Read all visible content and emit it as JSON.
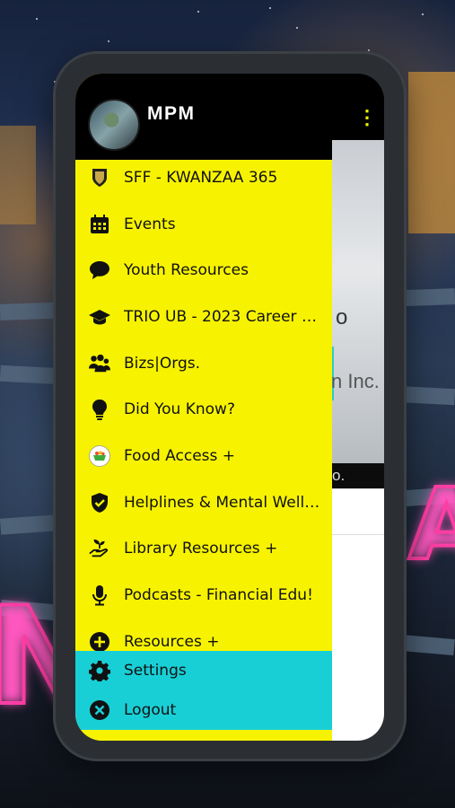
{
  "header": {
    "user_name": "MPM"
  },
  "menu": {
    "items": [
      {
        "label": "SFF - KWANZAA 365",
        "icon": "shield-badge-icon"
      },
      {
        "label": "Events",
        "icon": "calendar-icon"
      },
      {
        "label": "Youth Resources",
        "icon": "speech-bubble-icon"
      },
      {
        "label": "TRIO UB - 2023 Career R...",
        "icon": "graduation-cap-icon"
      },
      {
        "label": "Bizs|Orgs.",
        "icon": "group-icon"
      },
      {
        "label": "Did You Know?",
        "icon": "lightbulb-icon"
      },
      {
        "label": "Food Access +",
        "icon": "food-basket-icon"
      },
      {
        "label": "Helplines & Mental Welln...",
        "icon": "shield-check-icon"
      },
      {
        "label": "Library Resources +",
        "icon": "seedling-icon"
      },
      {
        "label": "Podcasts - Financial Edu!",
        "icon": "microphone-icon"
      },
      {
        "label": "Resources +",
        "icon": "plus-circle-icon"
      }
    ],
    "settings_label": "Settings",
    "logout_label": "Logout"
  },
  "background_app": {
    "text_o": "o",
    "text_inc": "n Inc.",
    "text_strip": "o."
  },
  "colors": {
    "drawer": "#f7f300",
    "teal": "#19cfd6",
    "header": "#000000",
    "neon": "#ff3ea5"
  }
}
